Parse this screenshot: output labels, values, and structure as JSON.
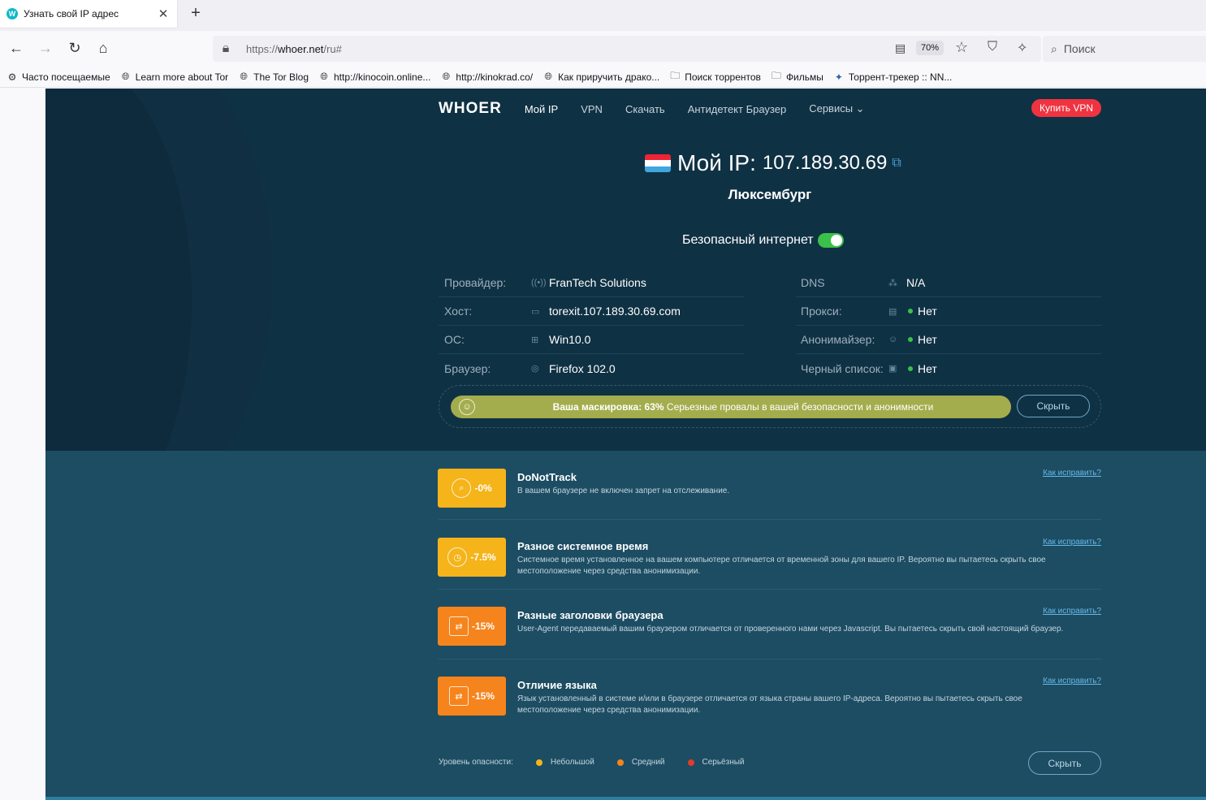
{
  "browser": {
    "tab_title": "Узнать свой IP адрес",
    "tab_close": "✕",
    "new_tab": "+",
    "url_prefix": "https://",
    "url_host": "whoer.net",
    "url_path": "/ru#",
    "zoom": "70%",
    "search_placeholder": "Поиск",
    "bookmarks": [
      {
        "label": "Часто посещаемые",
        "icon": "gear-icon"
      },
      {
        "label": "Learn more about Tor",
        "icon": "globe-icon"
      },
      {
        "label": "The Tor Blog",
        "icon": "globe-icon"
      },
      {
        "label": "http://kinocoin.online...",
        "icon": "globe-icon"
      },
      {
        "label": "http://kinokrad.co/",
        "icon": "globe-icon"
      },
      {
        "label": "Как приручить драко...",
        "icon": "globe-icon"
      },
      {
        "label": "Поиск торрентов",
        "icon": "folder-icon"
      },
      {
        "label": "Фильмы",
        "icon": "folder-icon"
      },
      {
        "label": "Торрент-трекер :: NN...",
        "icon": "butterfly-icon"
      }
    ]
  },
  "site": {
    "logo": "WHOER",
    "nav": [
      "Мой IP",
      "VPN",
      "Скачать",
      "Антидетект Браузер",
      "Сервисы ⌄"
    ],
    "buy_vpn": "Купить VPN",
    "ip_label": "Мой IP:",
    "ip_value": "107.189.30.69",
    "country": "Люксембург",
    "safe_internet": "Безопасный интернет",
    "info_left": [
      {
        "label": "Провайдер:",
        "icon": "signal-icon",
        "value": "FranTech Solutions"
      },
      {
        "label": "Хост:",
        "icon": "server-icon",
        "value": "torexit.107.189.30.69.com"
      },
      {
        "label": "ОС:",
        "icon": "windows-icon",
        "value": "Win10.0"
      },
      {
        "label": "Браузер:",
        "icon": "browser-icon",
        "value": "Firefox 102.0"
      }
    ],
    "info_right": [
      {
        "label": "DNS",
        "icon": "network-icon",
        "value": "N/A"
      },
      {
        "label": "Прокси:",
        "icon": "proxy-icon",
        "value": "Нет"
      },
      {
        "label": "Анонимайзер:",
        "icon": "user-icon",
        "value": "Нет"
      },
      {
        "label": "Черный список:",
        "icon": "list-icon",
        "value": "Нет"
      }
    ],
    "mask_label": "Ваша маскировка:",
    "mask_percent": "63%",
    "mask_text": "Серьезные провалы в вашей безопасности и анонимности",
    "mask_value": 0.63,
    "hide": "Скрыть",
    "issues": [
      {
        "badge": "-0%",
        "title": "DoNotTrack",
        "desc": "В вашем браузере не включен запрет на отслеживание.",
        "fix": "Как исправить?",
        "color": "#f4b41a"
      },
      {
        "badge": "-7.5%",
        "title": "Разное системное время",
        "desc": "Системное время установленное на вашем компьютере отличается от временной зоны для вашего IP. Вероятно вы пытаетесь скрыть свое местоположение через средства анонимизации.",
        "fix": "Как исправить?",
        "color": "#f4b41a"
      },
      {
        "badge": "-15%",
        "title": "Разные заголовки браузера",
        "desc": "User-Agent передаваемый вашим браузером отличается от проверенного нами через Javascript. Вы пытаетесь скрыть свой настоящий браузер.",
        "fix": "Как исправить?",
        "color": "#f6841d"
      },
      {
        "badge": "-15%",
        "title": "Отличие языка",
        "desc": "Язык установленный в системе и/или в браузере отличается от языка страны вашего IP-адреса. Вероятно вы пытаетесь скрыть свое местоположение через средства анонимизации.",
        "fix": "Как исправить?",
        "color": "#f6841d"
      }
    ],
    "legend_label": "Уровень опасности:",
    "legend": [
      {
        "label": "Небольшой",
        "color": "#f4b41a"
      },
      {
        "label": "Средний",
        "color": "#f6841d"
      },
      {
        "label": "Серьёзный",
        "color": "#e23a2e"
      }
    ]
  }
}
